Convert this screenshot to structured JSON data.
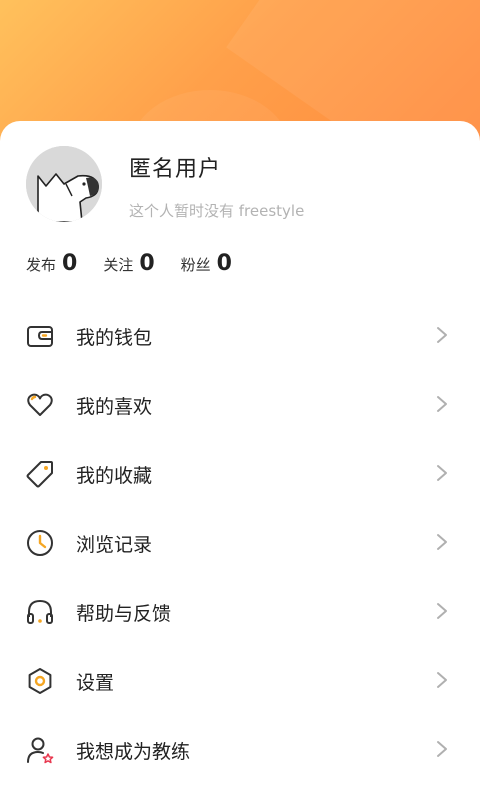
{
  "profile": {
    "name": "匿名用户",
    "bio": "这个人暂时没有 freestyle"
  },
  "stats": [
    {
      "label": "发布",
      "value": "0"
    },
    {
      "label": "关注",
      "value": "0"
    },
    {
      "label": "粉丝",
      "value": "0"
    }
  ],
  "menu": [
    {
      "label": "我的钱包",
      "icon": "wallet-icon"
    },
    {
      "label": "我的喜欢",
      "icon": "heart-icon"
    },
    {
      "label": "我的收藏",
      "icon": "tag-icon"
    },
    {
      "label": "浏览记录",
      "icon": "clock-icon"
    },
    {
      "label": "帮助与反馈",
      "icon": "headphones-icon"
    },
    {
      "label": "设置",
      "icon": "hexagon-settings-icon"
    },
    {
      "label": "我想成为教练",
      "icon": "user-star-icon"
    }
  ],
  "colors": {
    "accent": "#f5a623",
    "header_gradient_start": "#ffc15c",
    "header_gradient_end": "#ff8a3d",
    "star": "#e8384f"
  }
}
